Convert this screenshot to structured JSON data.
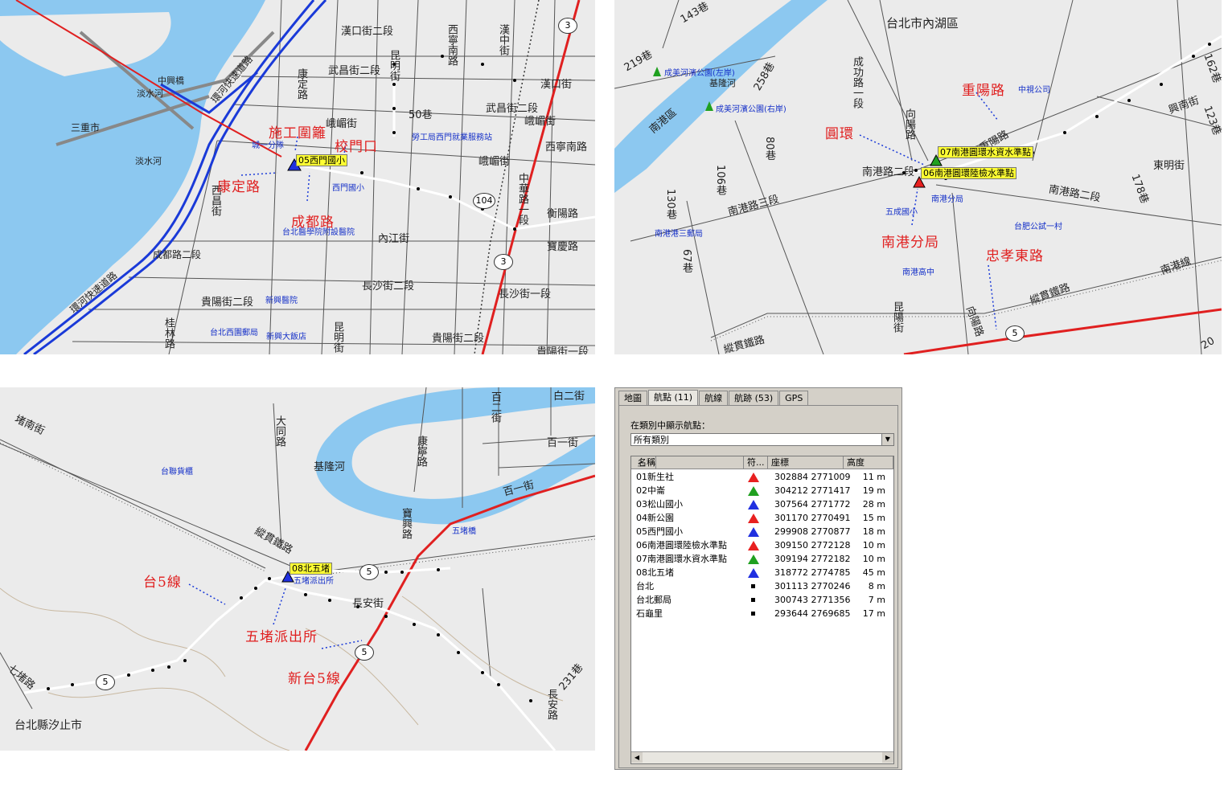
{
  "map1": {
    "streets": [
      "漢口街二段",
      "武昌街二段",
      "峨嵋街",
      "昆明街",
      "西寧南路",
      "康定路",
      "漢中街",
      "漢口街",
      "50巷",
      "武昌街二段",
      "峨嵋街",
      "西寧南路",
      "峨嵋街",
      "西昌街",
      "內江街",
      "長沙街二段",
      "長沙街一段",
      "貴陽街二段",
      "貴陽街一段",
      "貴陽街二段",
      "寶慶路",
      "衡陽路",
      "中華路一段",
      "淡水河",
      "淡水河",
      "三重市",
      "中興橋",
      "環河快速道路",
      "環河快速道路",
      "成都路二段",
      "昆明街",
      "桂林路"
    ],
    "pois": [
      "城一分隊",
      "勞工局西門就業服務站",
      "西門國小",
      "台北醫學院附設醫院",
      "新興醫院",
      "台北西園郵局",
      "新興大飯店"
    ],
    "annotations": [
      "施工圍籬",
      "校門口",
      "康定路",
      "成都路"
    ],
    "waypoint": "05西門國小",
    "shields": [
      "3",
      "104",
      "3"
    ]
  },
  "map2": {
    "district": "台北市內湖區",
    "streets": [
      "143巷",
      "219巷",
      "基隆河",
      "南港區",
      "258巷",
      "成功路一段",
      "向陽路",
      "南港路二段",
      "南港路三段",
      "80巷",
      "106巷",
      "130巷",
      "67巷",
      "重陽路",
      "興南街",
      "東明街",
      "162巷",
      "123巷",
      "178巷",
      "南港路二段",
      "南港線",
      "縱貫鐵路",
      "縱貫鐵路",
      "昆陽街",
      "向陽路",
      "20"
    ],
    "pois": [
      "成美河濱公園(左岸)",
      "成美河濱公園(右岸)",
      "中視公司",
      "五成國小",
      "南港分局",
      "南港港三郵局",
      "台肥公試一村",
      "南港高中"
    ],
    "annotations": [
      "重陽路",
      "圓環",
      "南港分局",
      "忠孝東路"
    ],
    "waypoints": [
      "07南港圓環水資水準點",
      "06南港圓環陸檢水準點"
    ],
    "shield": "5"
  },
  "map3": {
    "district": "台北縣汐止市",
    "streets": [
      "堵南街",
      "大同路",
      "基隆河",
      "康寧路",
      "百二街",
      "百一街",
      "百一街",
      "縱貫鐵路",
      "寶興路",
      "長安街",
      "231巷",
      "七堵路",
      "長安路",
      "白二街"
    ],
    "pois": [
      "台聯貨櫃",
      "五堵橋",
      "五堵派出所"
    ],
    "annotations": [
      "台5線",
      "五堵派出所",
      "新台5線"
    ],
    "waypoint": "08北五堵",
    "shields": [
      "5",
      "5",
      "5"
    ]
  },
  "panel": {
    "tabs": [
      "地圖",
      "航點 (11)",
      "航線",
      "航跡 (53)",
      "GPS"
    ],
    "category_label": "在類別中顯示航點：",
    "category_value": "所有類別",
    "columns": [
      "名稱",
      "符...",
      "座標",
      "高度"
    ],
    "rows": [
      {
        "name": "01新生社",
        "sym": "red",
        "coord": "302884 2771009",
        "alt": "11 m"
      },
      {
        "name": "02中崙",
        "sym": "green",
        "coord": "304212 2771417",
        "alt": "19 m"
      },
      {
        "name": "03松山國小",
        "sym": "blue",
        "coord": "307564 2771772",
        "alt": "28 m"
      },
      {
        "name": "04新公園",
        "sym": "red",
        "coord": "301170 2770491",
        "alt": "15 m"
      },
      {
        "name": "05西門國小",
        "sym": "blue",
        "coord": "299908 2770877",
        "alt": "18 m"
      },
      {
        "name": "06南港圓環陸檢水準點",
        "sym": "red",
        "coord": "309150 2772128",
        "alt": "10 m"
      },
      {
        "name": "07南港圓環水資水準點",
        "sym": "green",
        "coord": "309194 2772182",
        "alt": "10 m"
      },
      {
        "name": "08北五堵",
        "sym": "blue",
        "coord": "318772 2774785",
        "alt": "45 m"
      },
      {
        "name": "台北",
        "sym": "square",
        "coord": "301113 2770246",
        "alt": "8 m"
      },
      {
        "name": "台北郵局",
        "sym": "square",
        "coord": "300743 2771356",
        "alt": "7 m"
      },
      {
        "name": "石龜里",
        "sym": "square",
        "coord": "293644 2769685",
        "alt": "17 m"
      }
    ]
  },
  "colors": {
    "water": "#8cc8f0",
    "road": "#ffffff",
    "highway": "#e02020",
    "expressway": "#1a3ad8",
    "annotation": "#e02020",
    "waypoint_bg": "#ffff33",
    "poi": "#1530c8",
    "land": "#ebebeb"
  }
}
